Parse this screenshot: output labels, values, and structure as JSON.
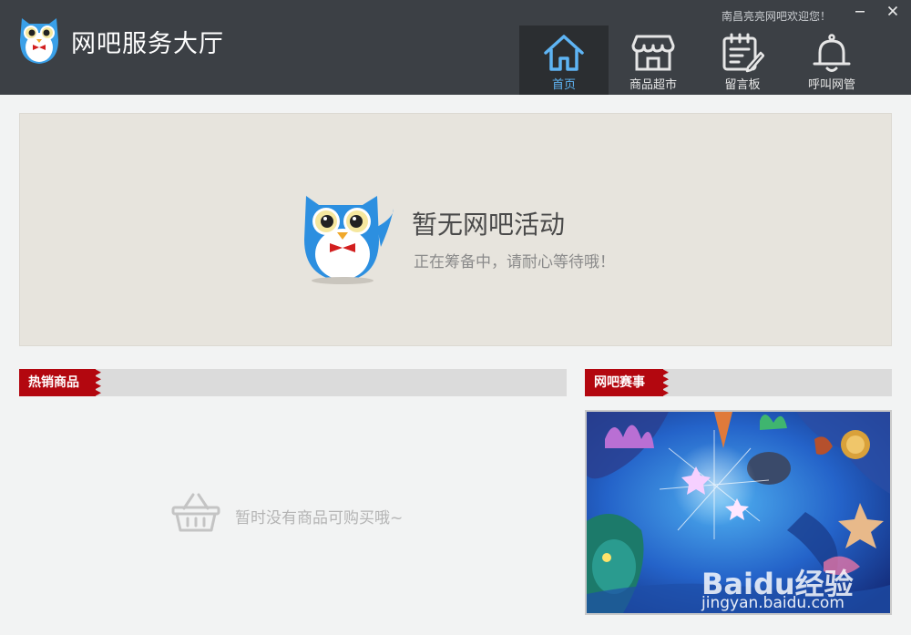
{
  "header": {
    "title": "网吧服务大厅",
    "welcome": "南昌亮亮网吧欢迎您！",
    "nav": [
      {
        "label": "首页",
        "icon": "home-icon",
        "active": true
      },
      {
        "label": "商品超市",
        "icon": "store-icon",
        "active": false
      },
      {
        "label": "留言板",
        "icon": "notepad-icon",
        "active": false
      },
      {
        "label": "呼叫网管",
        "icon": "bell-icon",
        "active": false
      }
    ]
  },
  "banner": {
    "title": "暂无网吧活动",
    "subtitle": "正在筹备中，请耐心等待哦！"
  },
  "hot_goods": {
    "tag": "热销商品",
    "empty_text": "暂时没有商品可购买哦~"
  },
  "events": {
    "tag": "网吧赛事",
    "watermark": "Baidu经验",
    "watermark_url": "jingyan.baidu.com"
  },
  "colors": {
    "header_bg": "#3c4045",
    "active_nav_bg": "#2b2e31",
    "accent_blue": "#5eb4f4",
    "tag_red": "#b3070f"
  }
}
